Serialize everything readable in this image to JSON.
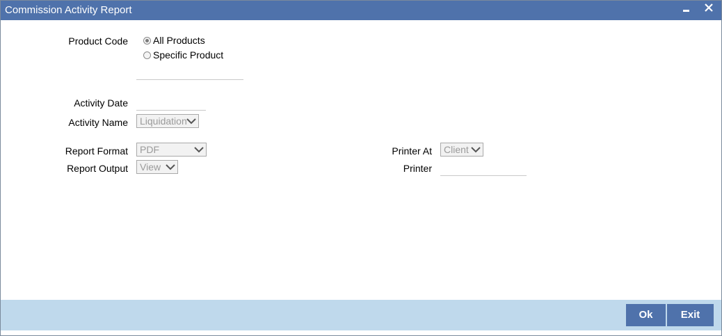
{
  "window": {
    "title": "Commission Activity Report"
  },
  "product_code": {
    "label": "Product Code",
    "options": [
      {
        "label": "All Products",
        "checked": true
      },
      {
        "label": "Specific Product",
        "checked": false
      }
    ],
    "specific_value": ""
  },
  "activity_date": {
    "label": "Activity Date",
    "value": ""
  },
  "activity_name": {
    "label": "Activity Name",
    "selected": "Liquidation"
  },
  "report_format": {
    "label": "Report Format",
    "selected": "PDF"
  },
  "report_output": {
    "label": "Report Output",
    "selected": "View"
  },
  "printer_at": {
    "label": "Printer At",
    "selected": "Client"
  },
  "printer": {
    "label": "Printer",
    "value": ""
  },
  "buttons": {
    "ok": "Ok",
    "exit": "Exit"
  },
  "colors": {
    "titlebar": "#4f72ab",
    "footer": "#bfd9ec",
    "button": "#4f72ab"
  },
  "icons": [
    "minimize-icon",
    "close-icon",
    "chevron-down-icon"
  ]
}
